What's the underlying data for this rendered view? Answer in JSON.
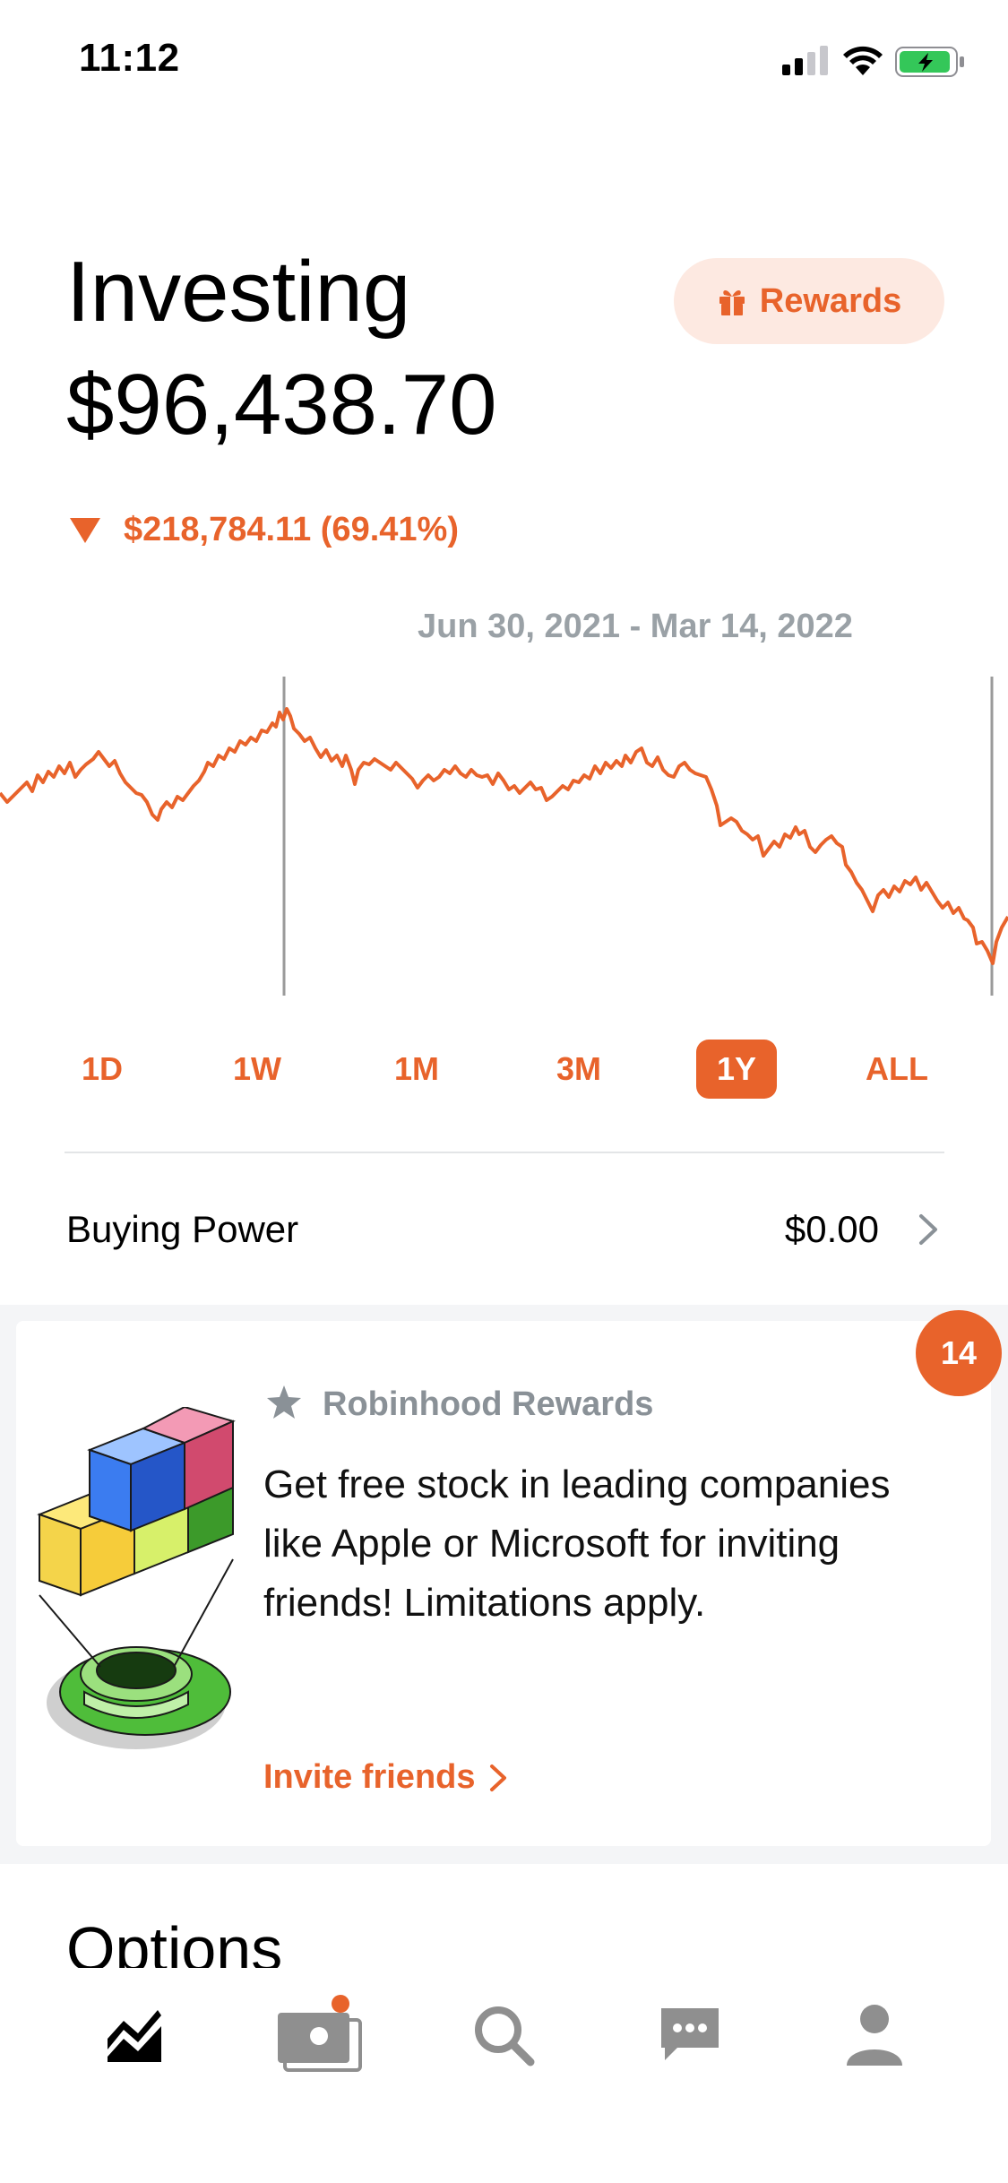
{
  "status_bar": {
    "time": "11:12"
  },
  "header": {
    "title": "Investing",
    "portfolio_value": "$96,438.70",
    "rewards_button": "Rewards"
  },
  "change": {
    "amount_text": "$218,784.11 (69.41%)",
    "direction": "down"
  },
  "chart": {
    "date_range": "Jun 30, 2021 - Mar 14, 2022"
  },
  "range_tabs": [
    {
      "label": "1D",
      "active": false
    },
    {
      "label": "1W",
      "active": false
    },
    {
      "label": "1M",
      "active": false
    },
    {
      "label": "3M",
      "active": false
    },
    {
      "label": "1Y",
      "active": true
    },
    {
      "label": "ALL",
      "active": false
    }
  ],
  "buying_power": {
    "label": "Buying Power",
    "value": "$0.00"
  },
  "promo": {
    "tag": "Robinhood Rewards",
    "text": "Get free stock in leading companies like Apple or Microsoft for inviting friends! Limitations apply.",
    "link": "Invite friends",
    "badge_count": "14"
  },
  "options": {
    "title": "Options"
  },
  "tab_bar": [
    {
      "icon": "investing-chart-icon",
      "active": true
    },
    {
      "icon": "cash-card-icon",
      "has_notification": true
    },
    {
      "icon": "search-icon"
    },
    {
      "icon": "messages-icon"
    },
    {
      "icon": "account-icon"
    }
  ],
  "colors": {
    "accent": "#e8632b",
    "muted": "#9aa1a6",
    "accent_light": "#fde9e1"
  }
}
